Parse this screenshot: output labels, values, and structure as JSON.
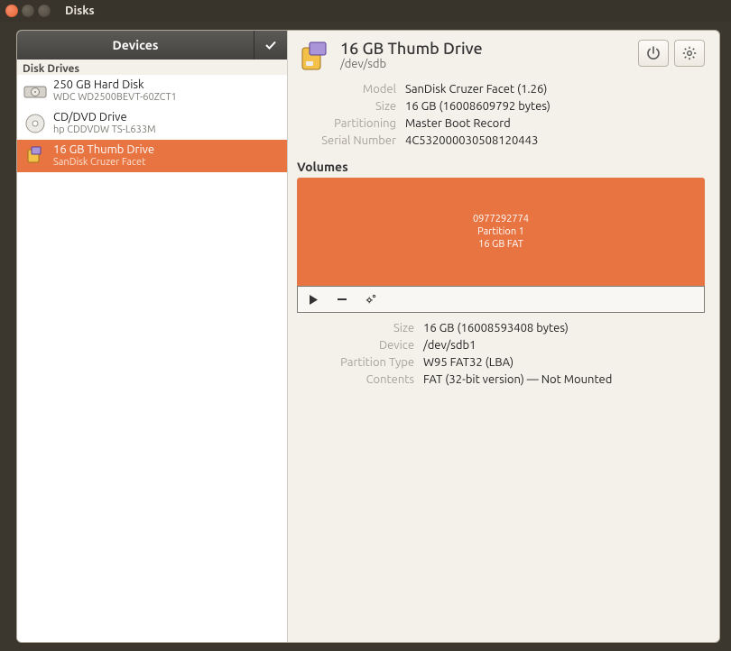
{
  "window": {
    "title": "Disks"
  },
  "sidebar": {
    "header": "Devices",
    "section": "Disk Drives",
    "drives": [
      {
        "title": "250 GB Hard Disk",
        "sub": "WDC WD2500BEVT-60ZCT1",
        "icon": "hdd"
      },
      {
        "title": "CD/DVD Drive",
        "sub": "hp       CDDVDW TS-L633M",
        "icon": "optical"
      },
      {
        "title": "16 GB Thumb Drive",
        "sub": "SanDisk Cruzer Facet",
        "icon": "usb",
        "selected": true
      }
    ]
  },
  "details": {
    "title": "16 GB Thumb Drive",
    "subtitle": "/dev/sdb",
    "rows": {
      "model_k": "Model",
      "model_v": "SanDisk Cruzer Facet (1.26)",
      "size_k": "Size",
      "size_v": "16 GB (16008609792 bytes)",
      "part_k": "Partitioning",
      "part_v": "Master Boot Record",
      "serial_k": "Serial Number",
      "serial_v": "4C532000030508120443"
    }
  },
  "volumes": {
    "section": "Volumes",
    "partition": {
      "name": "0977292774",
      "label": "Partition 1",
      "size": "16 GB FAT"
    },
    "rows": {
      "size_k": "Size",
      "size_v": "16 GB (16008593408 bytes)",
      "device_k": "Device",
      "device_v": "/dev/sdb1",
      "ptype_k": "Partition Type",
      "ptype_v": "W95 FAT32 (LBA)",
      "contents_k": "Contents",
      "contents_v": "FAT (32-bit version) — Not Mounted"
    }
  }
}
